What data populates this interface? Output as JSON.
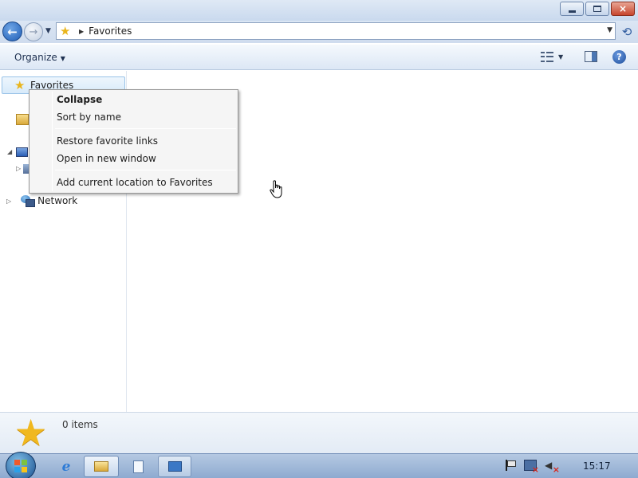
{
  "window": {
    "minimize_glyph": "minimize-icon",
    "maximize_glyph": "restore-icon",
    "close_label": "×"
  },
  "navigation": {
    "back_arrow": "←",
    "forward_arrow": "→",
    "address": {
      "icon": "star-icon",
      "path": "Favorites"
    }
  },
  "toolbar": {
    "organize_label": "Organize",
    "help_label": "?"
  },
  "nav_pane": {
    "favorites_label": "Favorites",
    "network_label": "Network"
  },
  "context_menu": {
    "items": [
      {
        "label": "Collapse",
        "default": true
      },
      {
        "label": "Sort by name"
      },
      {
        "label": "Restore favorite links"
      },
      {
        "label": "Open in new window"
      },
      {
        "label": "Add current location to Favorites"
      }
    ]
  },
  "details_pane": {
    "item_count": "0 items"
  },
  "taskbar": {
    "ie_label": "e",
    "clock": "15:17"
  },
  "colors": {
    "accent": "#1f5db5",
    "star": "#f0b81f",
    "selection": "#d7eafa"
  }
}
